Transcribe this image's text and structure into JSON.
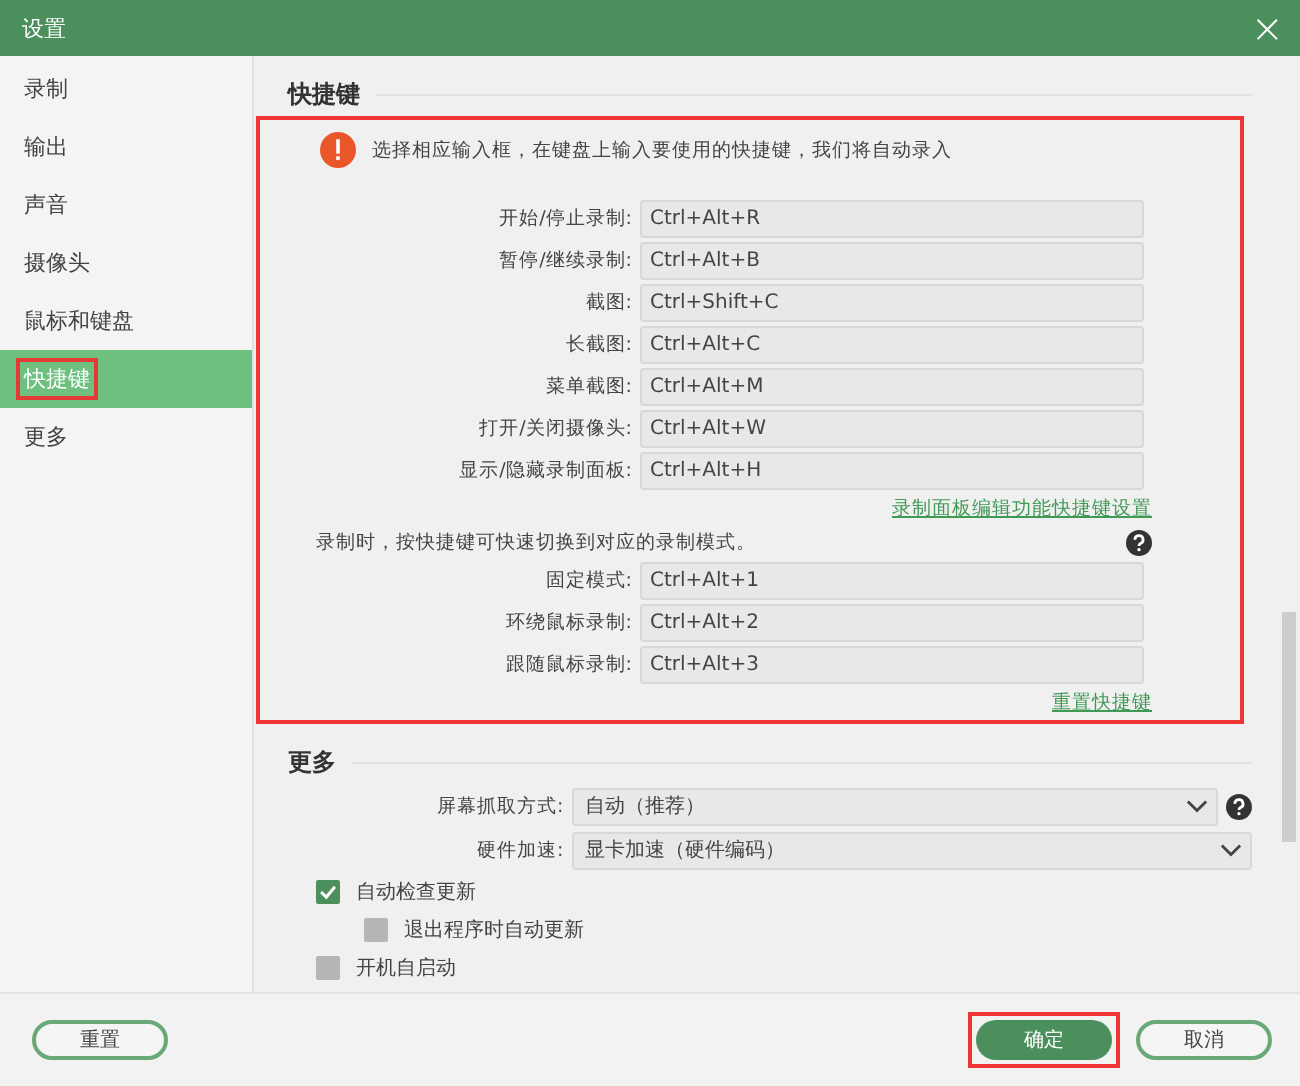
{
  "window": {
    "title": "设置",
    "close": "×"
  },
  "sidebar": {
    "items": [
      {
        "label": "录制",
        "selected": false,
        "highlighted": false
      },
      {
        "label": "输出",
        "selected": false,
        "highlighted": false
      },
      {
        "label": "声音",
        "selected": false,
        "highlighted": false
      },
      {
        "label": "摄像头",
        "selected": false,
        "highlighted": false
      },
      {
        "label": "鼠标和键盘",
        "selected": false,
        "highlighted": false
      },
      {
        "label": "快捷键",
        "selected": true,
        "highlighted": true
      },
      {
        "label": "更多",
        "selected": false,
        "highlighted": false
      }
    ]
  },
  "hotkeys": {
    "title": "快捷键",
    "highlighted": true,
    "notice": "选择相应输入框，在键盘上输入要使用的快捷键，我们将自动录入",
    "fields": [
      {
        "label": "开始/停止录制:",
        "value": "Ctrl+Alt+R"
      },
      {
        "label": "暂停/继续录制:",
        "value": "Ctrl+Alt+B"
      },
      {
        "label": "截图:",
        "value": "Ctrl+Shift+C"
      },
      {
        "label": "长截图:",
        "value": "Ctrl+Alt+C"
      },
      {
        "label": "菜单截图:",
        "value": "Ctrl+Alt+M"
      },
      {
        "label": "打开/关闭摄像头:",
        "value": "Ctrl+Alt+W"
      },
      {
        "label": "显示/隐藏录制面板:",
        "value": "Ctrl+Alt+H"
      }
    ],
    "panel_link": "录制面板编辑功能快捷键设置",
    "mode_note": "录制时，按快捷键可快速切换到对应的录制模式。",
    "mode_fields": [
      {
        "label": "固定模式:",
        "value": "Ctrl+Alt+1"
      },
      {
        "label": "环绕鼠标录制:",
        "value": "Ctrl+Alt+2"
      },
      {
        "label": "跟随鼠标录制:",
        "value": "Ctrl+Alt+3"
      }
    ],
    "reset_link": "重置快捷键"
  },
  "more": {
    "title": "更多",
    "selects": [
      {
        "label": "屏幕抓取方式:",
        "value": "自动（推荐）",
        "help": true
      },
      {
        "label": "硬件加速:",
        "value": "显卡加速（硬件编码）",
        "help": false
      }
    ],
    "checkboxes": [
      {
        "label": "自动检查更新",
        "checked": true,
        "indent": false
      },
      {
        "label": "退出程序时自动更新",
        "checked": false,
        "indent": true
      },
      {
        "label": "开机自启动",
        "checked": false,
        "indent": false
      }
    ]
  },
  "buttons": [
    {
      "label": "重置",
      "kind": "outline",
      "highlighted": false
    },
    {
      "label": "确定",
      "kind": "primary",
      "highlighted": true
    },
    {
      "label": "取消",
      "kind": "outline",
      "highlighted": false
    }
  ]
}
